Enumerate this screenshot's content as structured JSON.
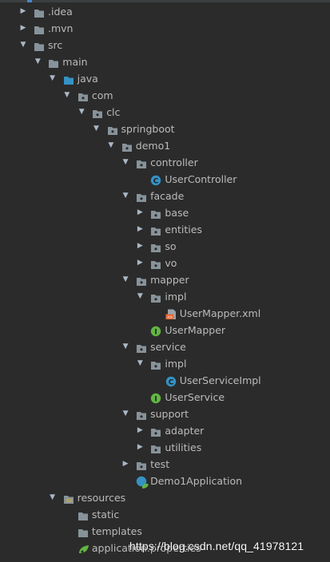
{
  "tree": [
    {
      "label": ".idea",
      "depth": 0,
      "arrow": "right",
      "icon": "folder"
    },
    {
      "label": ".mvn",
      "depth": 0,
      "arrow": "right",
      "icon": "folder"
    },
    {
      "label": "src",
      "depth": 0,
      "arrow": "down",
      "icon": "folder"
    },
    {
      "label": "main",
      "depth": 1,
      "arrow": "down",
      "icon": "folder"
    },
    {
      "label": "java",
      "depth": 2,
      "arrow": "down",
      "icon": "folder-source"
    },
    {
      "label": "com",
      "depth": 3,
      "arrow": "down",
      "icon": "package"
    },
    {
      "label": "clc",
      "depth": 4,
      "arrow": "down",
      "icon": "package"
    },
    {
      "label": "springboot",
      "depth": 5,
      "arrow": "down",
      "icon": "package"
    },
    {
      "label": "demo1",
      "depth": 6,
      "arrow": "down",
      "icon": "package"
    },
    {
      "label": "controller",
      "depth": 7,
      "arrow": "down",
      "icon": "package"
    },
    {
      "label": "UserController",
      "depth": 8,
      "arrow": "none",
      "icon": "class"
    },
    {
      "label": "facade",
      "depth": 7,
      "arrow": "down",
      "icon": "package"
    },
    {
      "label": "base",
      "depth": 8,
      "arrow": "right",
      "icon": "package"
    },
    {
      "label": "entities",
      "depth": 8,
      "arrow": "right",
      "icon": "package"
    },
    {
      "label": "so",
      "depth": 8,
      "arrow": "right",
      "icon": "package"
    },
    {
      "label": "vo",
      "depth": 8,
      "arrow": "right",
      "icon": "package"
    },
    {
      "label": "mapper",
      "depth": 7,
      "arrow": "down",
      "icon": "package"
    },
    {
      "label": "impl",
      "depth": 8,
      "arrow": "down",
      "icon": "package"
    },
    {
      "label": "UserMapper.xml",
      "depth": 9,
      "arrow": "none",
      "icon": "xml"
    },
    {
      "label": "UserMapper",
      "depth": 8,
      "arrow": "none",
      "icon": "interface"
    },
    {
      "label": "service",
      "depth": 7,
      "arrow": "down",
      "icon": "package"
    },
    {
      "label": "impl",
      "depth": 8,
      "arrow": "down",
      "icon": "package"
    },
    {
      "label": "UserServiceImpl",
      "depth": 9,
      "arrow": "none",
      "icon": "class"
    },
    {
      "label": "UserService",
      "depth": 8,
      "arrow": "none",
      "icon": "interface"
    },
    {
      "label": "support",
      "depth": 7,
      "arrow": "down",
      "icon": "package"
    },
    {
      "label": "adapter",
      "depth": 8,
      "arrow": "right",
      "icon": "package"
    },
    {
      "label": "utilities",
      "depth": 8,
      "arrow": "right",
      "icon": "package"
    },
    {
      "label": "test",
      "depth": 7,
      "arrow": "right",
      "icon": "package"
    },
    {
      "label": "Demo1Application",
      "depth": 7,
      "arrow": "none",
      "icon": "spring-class"
    },
    {
      "label": "resources",
      "depth": 2,
      "arrow": "down",
      "icon": "folder-resources"
    },
    {
      "label": "static",
      "depth": 3,
      "arrow": "none",
      "icon": "folder"
    },
    {
      "label": "templates",
      "depth": 3,
      "arrow": "none",
      "icon": "folder"
    },
    {
      "label": "application.properties",
      "depth": 3,
      "arrow": "none",
      "icon": "properties"
    }
  ],
  "watermark": "https://blog.csdn.net/qq_41978121",
  "colors": {
    "background": "#2b2b2b",
    "text": "#bbbbbb",
    "folder": "#87939a",
    "source_folder": "#3592c4",
    "class": "#3592c4",
    "interface": "#62b543",
    "xml": "#e56d3b",
    "spring": "#62b543"
  }
}
